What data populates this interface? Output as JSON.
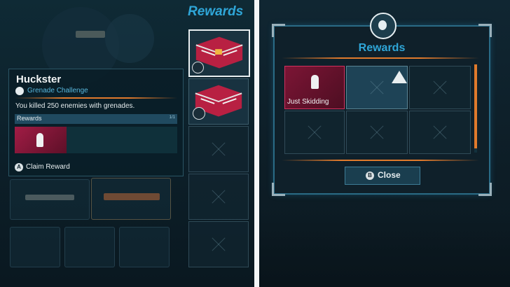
{
  "left": {
    "rewards_header": "Rewards",
    "challenge": {
      "title": "Huckster",
      "category": "Grenade Challenge",
      "description": "You killed 250 enemies with grenades.",
      "rewards_label": "Rewards",
      "rewards_count": "1/1",
      "claim_key": "A",
      "claim_label": "Claim Reward"
    }
  },
  "right": {
    "title": "Rewards",
    "item_label": "Just Skidding",
    "close_key": "B",
    "close_label": "Close"
  },
  "colors": {
    "accent_blue": "#2fa6d8",
    "reward_magenta": "#b0204f",
    "orange": "#e07a2c"
  }
}
